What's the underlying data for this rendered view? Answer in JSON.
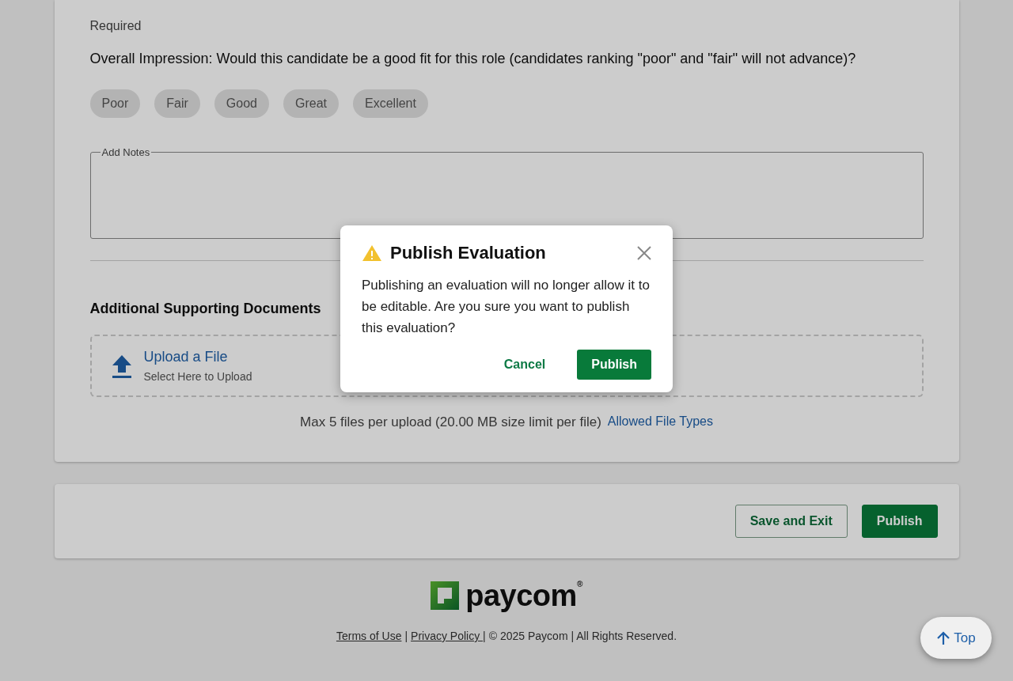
{
  "required_label": "Required",
  "question": "Overall Impression: Would this candidate be a good fit for this role (candidates ranking \"poor\" and \"fair\" will not advance)?",
  "ratings": [
    {
      "label": "Poor",
      "selected": false
    },
    {
      "label": "Fair",
      "selected": false
    },
    {
      "label": "Good",
      "selected": false
    },
    {
      "label": "Great",
      "selected": false
    },
    {
      "label": "Excellent",
      "selected": false
    }
  ],
  "notes": {
    "label": "Add Notes"
  },
  "documents": {
    "heading": "Additional Supporting Documents",
    "upload_title": "Upload a File",
    "upload_hint": "Select Here to Upload",
    "limit_text": "Max 5 files per upload (20.00 MB size limit per file)",
    "allowed_link": "Allowed File Types"
  },
  "actions": [
    {
      "label": "Save and Exit",
      "kind": "outline"
    },
    {
      "label": "Publish",
      "kind": "primary"
    }
  ],
  "footer": {
    "logo": "paycom",
    "logo_mark": "®",
    "items": [
      {
        "text": "Terms of Use",
        "kind": "link"
      },
      {
        "text": "|",
        "kind": "text"
      },
      {
        "text": "Privacy Policy |",
        "kind": "link"
      },
      {
        "text": "© 2025 Paycom | All Rights Reserved.",
        "kind": "text"
      }
    ]
  },
  "top_button": "Top",
  "dialog": {
    "title": "Publish Evaluation",
    "message": "Publishing an evaluation will no longer allow it to be editable. Are you sure you want to publish this evaluation?",
    "buttons": [
      {
        "label": "Cancel",
        "kind": "text"
      },
      {
        "label": "Publish",
        "kind": "primary"
      }
    ]
  }
}
